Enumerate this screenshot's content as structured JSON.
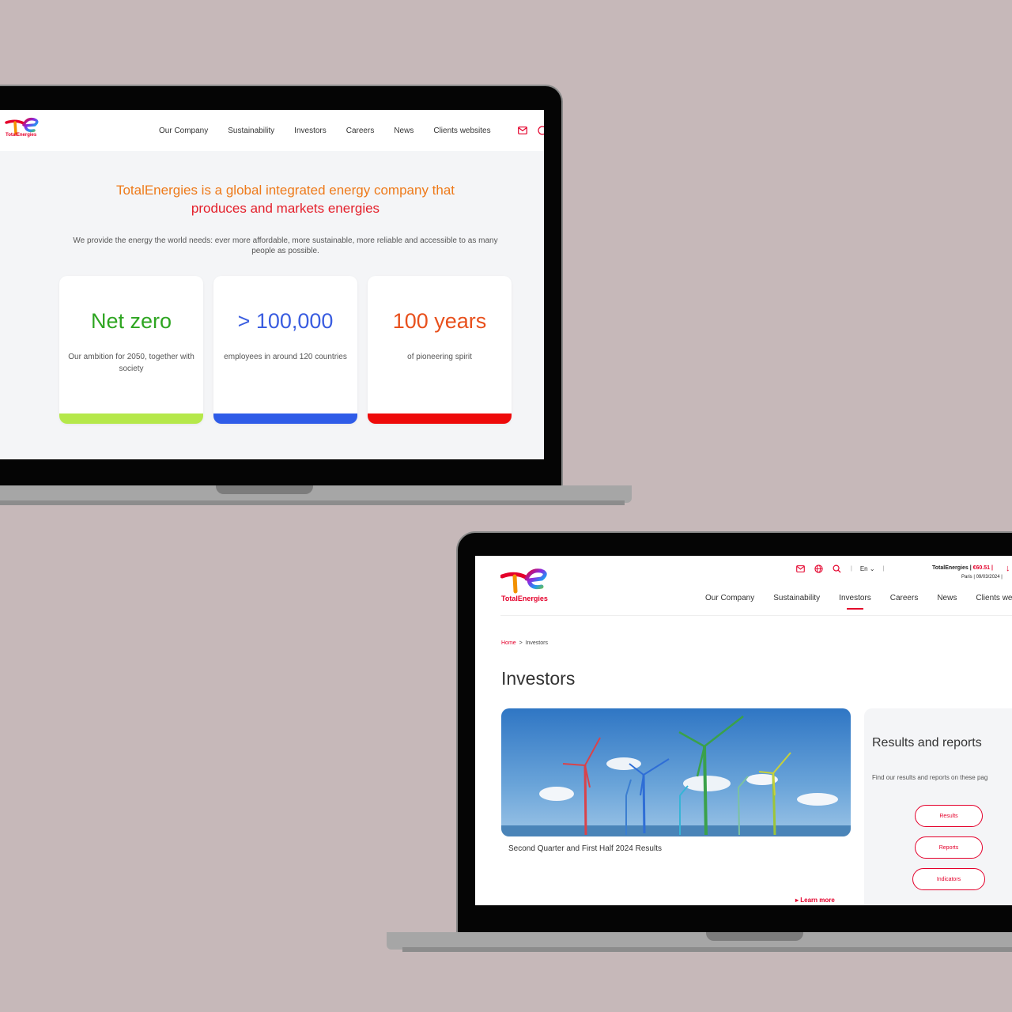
{
  "colors": {
    "brand_red": "#e4002b",
    "orange": "#ee7a1a",
    "green_accent": "#b5e84a",
    "blue_accent": "#2f5ce8",
    "red_accent": "#ee0a0a",
    "background": "#c6b8b9"
  },
  "homepage": {
    "logo_text": "TotalEnergies",
    "nav": [
      "Our Company",
      "Sustainability",
      "Investors",
      "Careers",
      "News",
      "Clients websites"
    ],
    "header_icons": [
      "mail-icon",
      "globe-icon"
    ],
    "headline_line1": "TotalEnergies is a global integrated energy company that",
    "headline_line2": "produces and markets energies",
    "subtitle": "We provide the energy the world needs: ever more affordable, more sustainable, more reliable and accessible to as many people as possible.",
    "cards": [
      {
        "value": "Net zero",
        "text": "Our ambition for 2050, together with society",
        "color": "#2ea521",
        "bar": "#b5e84a"
      },
      {
        "value": "> 100,000",
        "text": "employees in around 120 countries",
        "color": "#3a5de0",
        "bar": "#2f5ce8"
      },
      {
        "value": "100 years",
        "text": "of pioneering spirit",
        "color": "#e8501c",
        "bar": "#ee0a0a"
      }
    ]
  },
  "investors": {
    "logo_text": "TotalEnergies",
    "top_icons": [
      "mail-icon",
      "globe-icon",
      "search-icon"
    ],
    "language": "En",
    "stock_name": "TotalEnergies |",
    "stock_price": "€60.51 |",
    "stock_place_date": "Paris |   09/03/2024 |",
    "nav": [
      "Our Company",
      "Sustainability",
      "Investors",
      "Careers",
      "News",
      "Clients we"
    ],
    "active_nav": "Investors",
    "breadcrumb_home": "Home",
    "breadcrumb_sep": ">",
    "breadcrumb_current": "Investors",
    "page_title": "Investors",
    "feature_caption": "Second Quarter and First Half 2024 Results",
    "learn_more": "Learn more",
    "panel_title": "Results and reports",
    "panel_sub": "Find our results and reports on these pag",
    "buttons": [
      "Results",
      "Reports",
      "Indicators"
    ]
  }
}
